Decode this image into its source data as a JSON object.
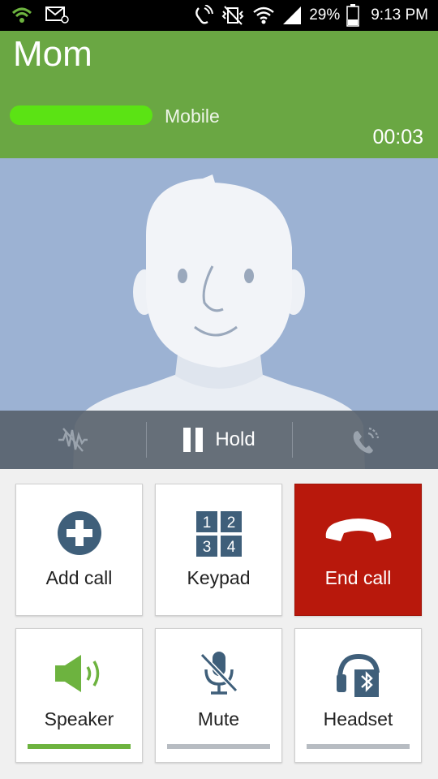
{
  "status_bar": {
    "battery": "29%",
    "time": "9:13 PM",
    "icons": [
      "wifi-call-icon",
      "email-icon",
      "nfc-icon",
      "vibrate-off-icon",
      "wifi-icon",
      "signal-icon",
      "battery-icon"
    ]
  },
  "contact": {
    "name": "Mom",
    "phone_type": "Mobile",
    "timer": "00:03"
  },
  "controls": {
    "hold_label": "Hold",
    "icons": [
      "noise-reduction-icon",
      "pause-icon",
      "extra-volume-icon"
    ]
  },
  "actions": {
    "add_call": "Add call",
    "keypad": "Keypad",
    "keypad_digits": [
      "1",
      "2",
      "3",
      "4"
    ],
    "end_call": "End call",
    "speaker": "Speaker",
    "mute": "Mute",
    "headset": "Headset"
  },
  "colors": {
    "header_green": "#6aa743",
    "end_call_red": "#b8180c",
    "speaker_active": "#6db33f",
    "icon_blue": "#3f5f7a"
  },
  "speaker_active": true
}
